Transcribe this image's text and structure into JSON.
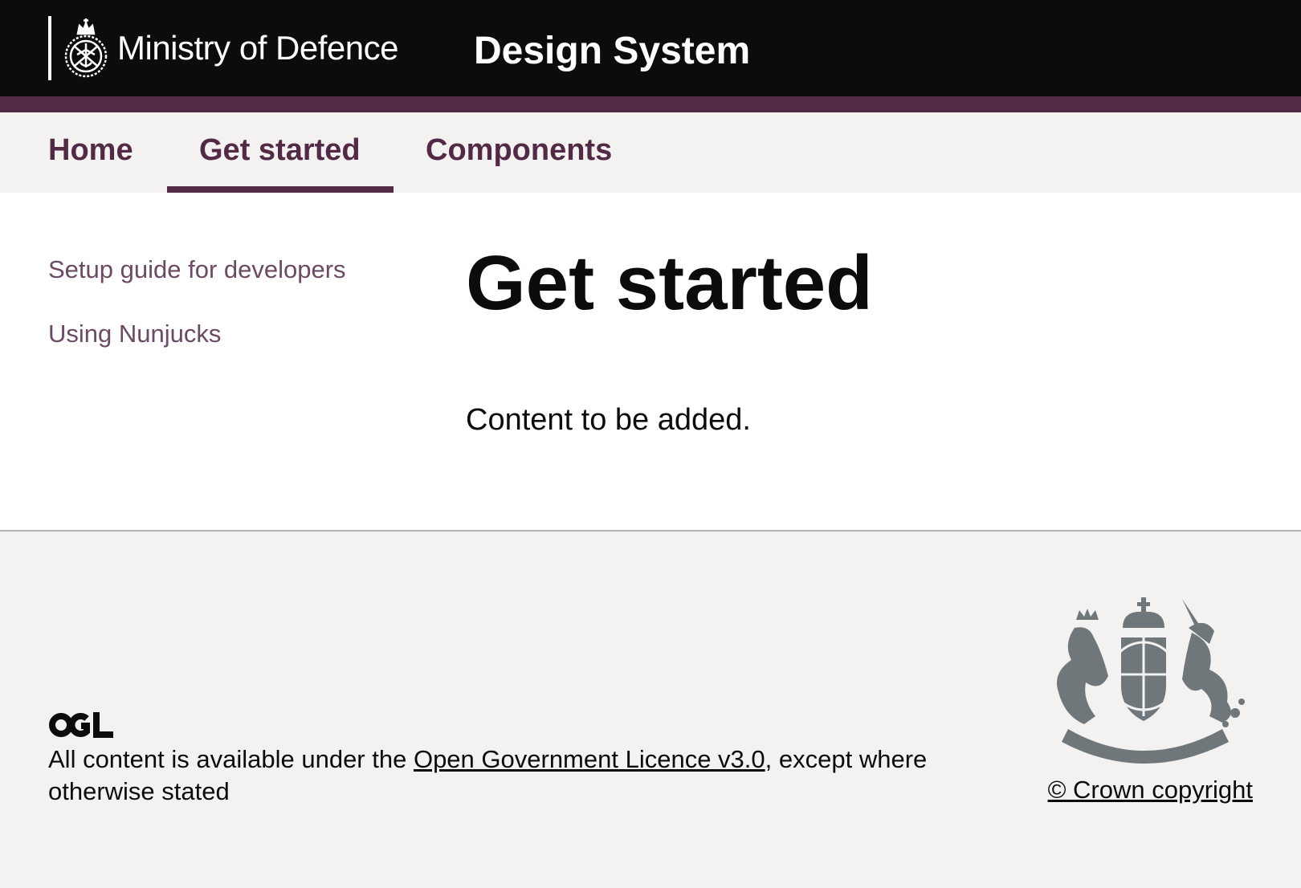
{
  "header": {
    "organisation": "Ministry of Defence",
    "service_name": "Design System",
    "background_color": "#0b0c0c",
    "stripe_color": "#532a45",
    "logo_icon": "mod-crest-icon"
  },
  "nav": {
    "items": [
      {
        "label": "Home",
        "active": false
      },
      {
        "label": "Get started",
        "active": true
      },
      {
        "label": "Components",
        "active": false
      }
    ],
    "accent_color": "#532a45"
  },
  "sidebar": {
    "items": [
      {
        "label": "Setup guide for developers"
      },
      {
        "label": "Using Nunjucks"
      }
    ]
  },
  "main": {
    "title": "Get started",
    "body": "Content to be added."
  },
  "footer": {
    "ogl_icon": "ogl-logo-icon",
    "licence_prefix": "All content is available under the ",
    "licence_link": "Open Government Licence v3.0",
    "licence_suffix": ", except where otherwise stated",
    "crest_icon": "royal-coat-of-arms-icon",
    "copyright": "© Crown copyright"
  }
}
